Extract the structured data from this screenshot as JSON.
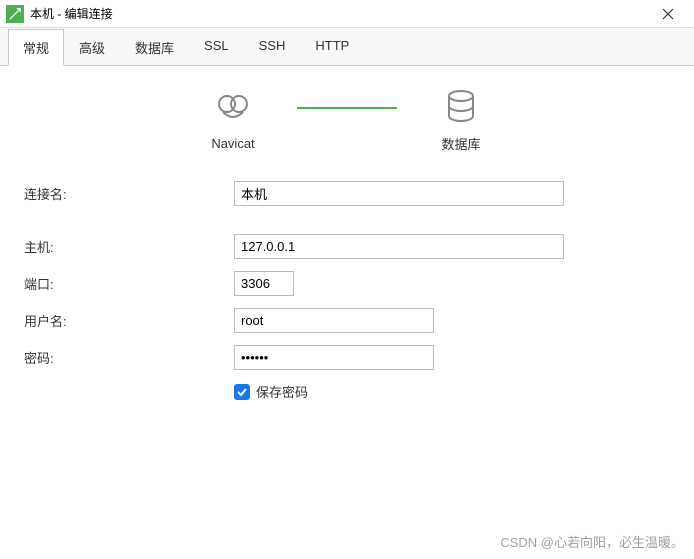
{
  "window": {
    "title": "本机 - 编辑连接"
  },
  "tabs": [
    {
      "label": "常规",
      "active": true
    },
    {
      "label": "高级",
      "active": false
    },
    {
      "label": "数据库",
      "active": false
    },
    {
      "label": "SSL",
      "active": false
    },
    {
      "label": "SSH",
      "active": false
    },
    {
      "label": "HTTP",
      "active": false
    }
  ],
  "visual": {
    "left_label": "Navicat",
    "right_label": "数据库"
  },
  "form": {
    "connection_name": {
      "label": "连接名:",
      "value": "本机"
    },
    "host": {
      "label": "主机:",
      "value": "127.0.0.1"
    },
    "port": {
      "label": "端口:",
      "value": "3306"
    },
    "username": {
      "label": "用户名:",
      "value": "root"
    },
    "password": {
      "label": "密码:",
      "value": "••••••"
    },
    "save_password": {
      "label": "保存密码",
      "checked": true
    }
  },
  "watermark": "CSDN @心若向阳，必生温暖。"
}
